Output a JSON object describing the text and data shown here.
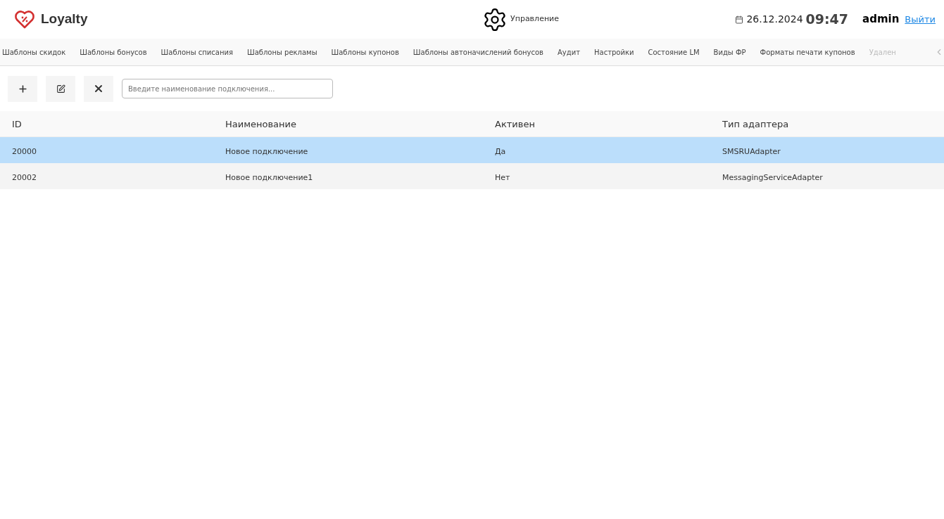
{
  "app": {
    "name": "Loyalty"
  },
  "header": {
    "section": "Управление",
    "date": "26.12.2024",
    "time": "09:47",
    "user": "admin",
    "logout": "Выйти"
  },
  "nav": [
    {
      "label": "Шаблоны скидок"
    },
    {
      "label": "Шаблоны бонусов"
    },
    {
      "label": "Шаблоны списания"
    },
    {
      "label": "Шаблоны рекламы"
    },
    {
      "label": "Шаблоны купонов"
    },
    {
      "label": "Шаблоны автоначислений бонусов"
    },
    {
      "label": "Аудит"
    },
    {
      "label": "Настройки"
    },
    {
      "label": "Состояние LM"
    },
    {
      "label": "Виды ФР"
    },
    {
      "label": "Форматы печати купонов"
    },
    {
      "label": "Удален"
    }
  ],
  "search": {
    "placeholder": "Введите наименование подключения..."
  },
  "table": {
    "columns": [
      "ID",
      "Наименование",
      "Активен",
      "Тип адаптера"
    ],
    "rows": [
      {
        "cells": [
          "20000",
          "Новое подключение",
          "Да",
          "SMSRUAdapter"
        ],
        "selected": true
      },
      {
        "cells": [
          "20002",
          "Новое подключение1",
          "Нет",
          "MessagingServiceAdapter"
        ],
        "selected": false
      }
    ]
  }
}
